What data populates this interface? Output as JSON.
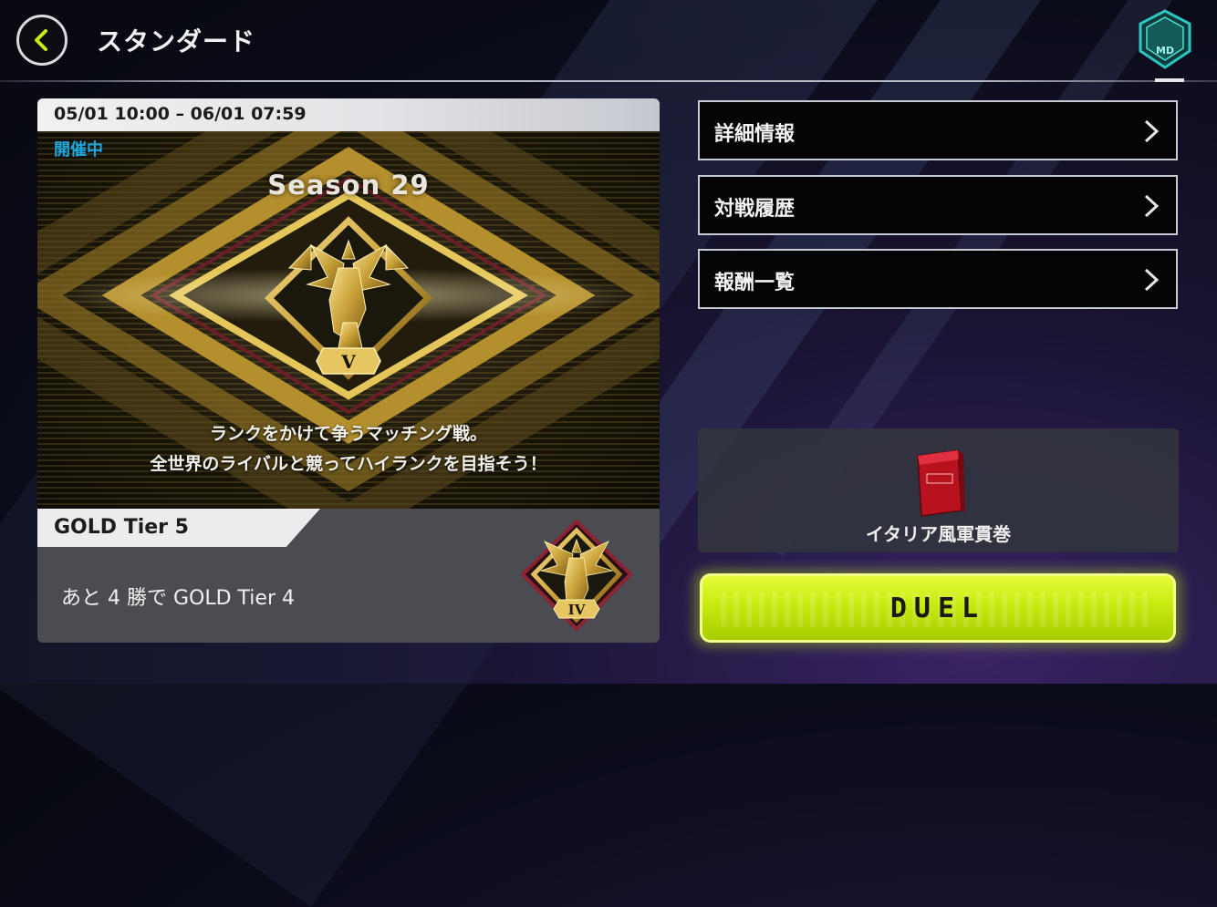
{
  "header": {
    "title": "スタンダード",
    "back_icon": "chevron-left-icon",
    "badge_text": "MD"
  },
  "season": {
    "date_range": "05/01 10:00 – 06/01 07:59",
    "status": "開催中",
    "title": "Season 29",
    "rank_numeral": "V",
    "description_line1": "ランクをかけて争うマッチング戦。",
    "description_line2": "全世界のライバルと競ってハイランクを目指そう！"
  },
  "tier": {
    "current": "GOLD Tier 5",
    "progress_text": "あと 4 勝で  GOLD Tier 4",
    "next_numeral": "IV"
  },
  "menu": {
    "items": [
      {
        "label": "詳細情報"
      },
      {
        "label": "対戦履歴"
      },
      {
        "label": "報酬一覧"
      }
    ]
  },
  "reward": {
    "label": "イタリア風軍貫巻",
    "icon": "red-box-icon"
  },
  "duel": {
    "label": "DUEL"
  },
  "colors": {
    "accent_lime": "#c8ea10",
    "status_blue": "#1fa7e0",
    "gold": "#c9a13a",
    "panel_dark": "#4b4c51"
  }
}
